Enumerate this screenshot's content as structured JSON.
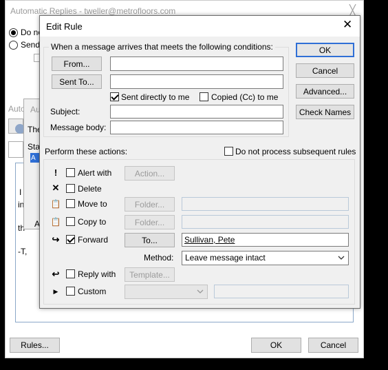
{
  "background_window": {
    "title": "Automatic Replies - tweller@metrofloors.com",
    "close_glyph": "╳",
    "radio_1": "Do no",
    "radio_2": "Send",
    "auto_label": "Auto",
    "au_label": "Au",
    "the_label": "The",
    "sta_label": "Sta",
    "a_label": "A",
    "a2_label": "A",
    "text_i": "I",
    "text_in": "in",
    "text_th": "th",
    "text_t": "-T,",
    "rules_button": "Rules...",
    "ok_button": "OK",
    "cancel_button": "Cancel"
  },
  "dialog": {
    "title": "Edit Rule",
    "close_glyph": "✕",
    "conditions": {
      "legend": "When a message arrives that meets the following conditions:",
      "from_button": "From...",
      "sent_to_button": "Sent To...",
      "sent_directly": "Sent directly to me",
      "copied": "Copied (Cc) to me",
      "subject_label": "Subject:",
      "body_label": "Message body:"
    },
    "side_buttons": {
      "ok": "OK",
      "cancel": "Cancel",
      "advanced": "Advanced...",
      "check_names": "Check Names"
    },
    "actions": {
      "legend": "Perform these actions:",
      "do_not_process": "Do not process subsequent rules",
      "alert_with": "Alert with",
      "action_button": "Action...",
      "delete": "Delete",
      "move_to": "Move to",
      "folder_button_1": "Folder...",
      "copy_to": "Copy to",
      "folder_button_2": "Folder...",
      "forward": "Forward",
      "to_button": "To...",
      "forward_value": "Sullivan, Pete",
      "method_label": "Method:",
      "method_value": "Leave message intact",
      "reply_with": "Reply with",
      "template_button": "Template...",
      "custom": "Custom"
    }
  },
  "icons": {
    "alert": "!",
    "delete": "✕",
    "move": "📋",
    "copy": "📋",
    "forward": "↪",
    "reply": "↩",
    "custom": "▶"
  }
}
